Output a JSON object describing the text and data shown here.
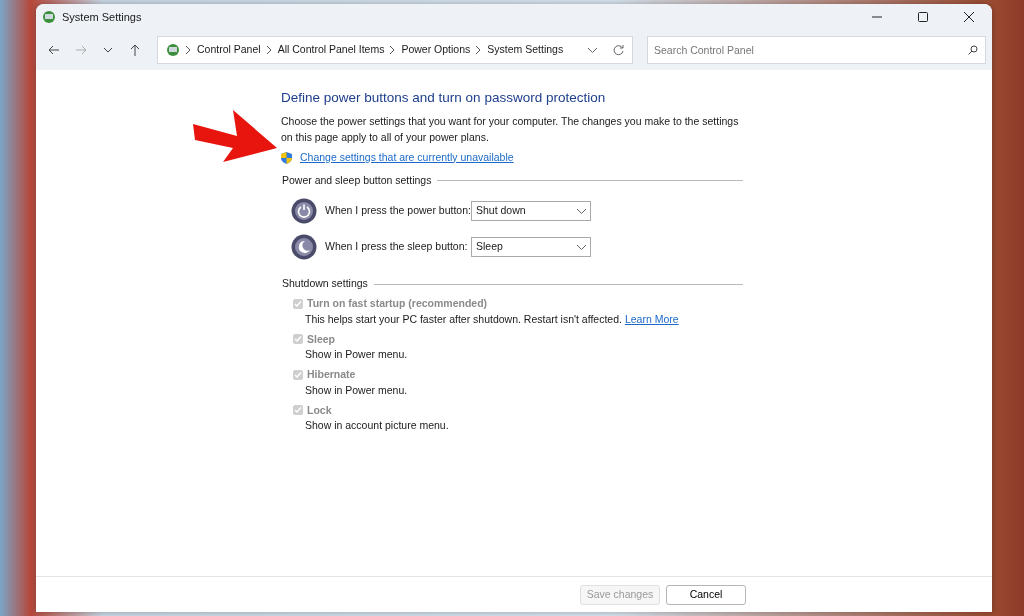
{
  "window": {
    "title": "System Settings"
  },
  "address_bar": {
    "breadcrumbs": [
      "Control Panel",
      "All Control Panel Items",
      "Power Options",
      "System Settings"
    ]
  },
  "search": {
    "placeholder": "Search Control Panel"
  },
  "heading": "Define power buttons and turn on password protection",
  "description": "Choose the power settings that you want for your computer. The changes you make to the settings on this page apply to all of your power plans.",
  "admin_link": "Change settings that are currently unavailable",
  "button_section": {
    "title": "Power and sleep button settings",
    "rows": [
      {
        "kind": "power",
        "label": "When I press the power button:",
        "value": "Shut down"
      },
      {
        "kind": "sleep",
        "label": "When I press the sleep button:",
        "value": "Sleep"
      }
    ]
  },
  "shutdown_section": {
    "title": "Shutdown settings",
    "options": [
      {
        "label": "Turn on fast startup (recommended)",
        "description": "This helps start your PC faster after shutdown. Restart isn't affected.",
        "link": "Learn More",
        "checked": true,
        "disabled": true
      },
      {
        "label": "Sleep",
        "description": "Show in Power menu.",
        "checked": true,
        "disabled": true
      },
      {
        "label": "Hibernate",
        "description": "Show in Power menu.",
        "checked": true,
        "disabled": true
      },
      {
        "label": "Lock",
        "description": "Show in account picture menu.",
        "checked": true,
        "disabled": true
      }
    ]
  },
  "footer_buttons": [
    {
      "label": "Save changes",
      "disabled": true
    },
    {
      "label": "Cancel",
      "disabled": false
    }
  ]
}
